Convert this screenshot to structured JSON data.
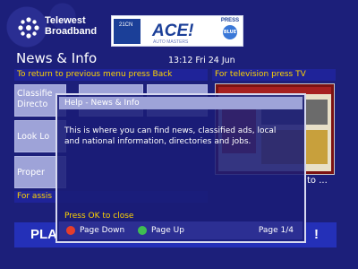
{
  "brand": {
    "line1": "Telewest",
    "line2": "Broadband"
  },
  "banner": {
    "small_text": "21CN",
    "title": "ACE!",
    "subtitle": "AUTO MASTERS",
    "press_label": "PRESS",
    "press_color_text": "BLUE"
  },
  "header": {
    "page_title": "News & Info",
    "clock": "13:12 Fri 24 Jun"
  },
  "bars": {
    "back": "To return to previous menu press Back",
    "tv": "For television press TV",
    "assist": "For assis"
  },
  "tiles": [
    {
      "label": "Classifie\nDirecto"
    },
    {
      "label": "Look Lo"
    },
    {
      "label": "Proper"
    }
  ],
  "tv_caption": "to ...",
  "promo": {
    "left": "PLA",
    "right": "!"
  },
  "help": {
    "title": "Help - News & Info",
    "body": "This is where you can find news, classified ads, local and national information, directories and jobs.",
    "ok_text": "Press OK to close",
    "page_down": "Page Down",
    "page_up": "Page Up",
    "page": "Page 1/4"
  },
  "colors": {
    "background": "#1c1f7a",
    "accent_yellow": "#ffd400",
    "red_button": "#e53d2b",
    "green_button": "#3fbd52"
  }
}
